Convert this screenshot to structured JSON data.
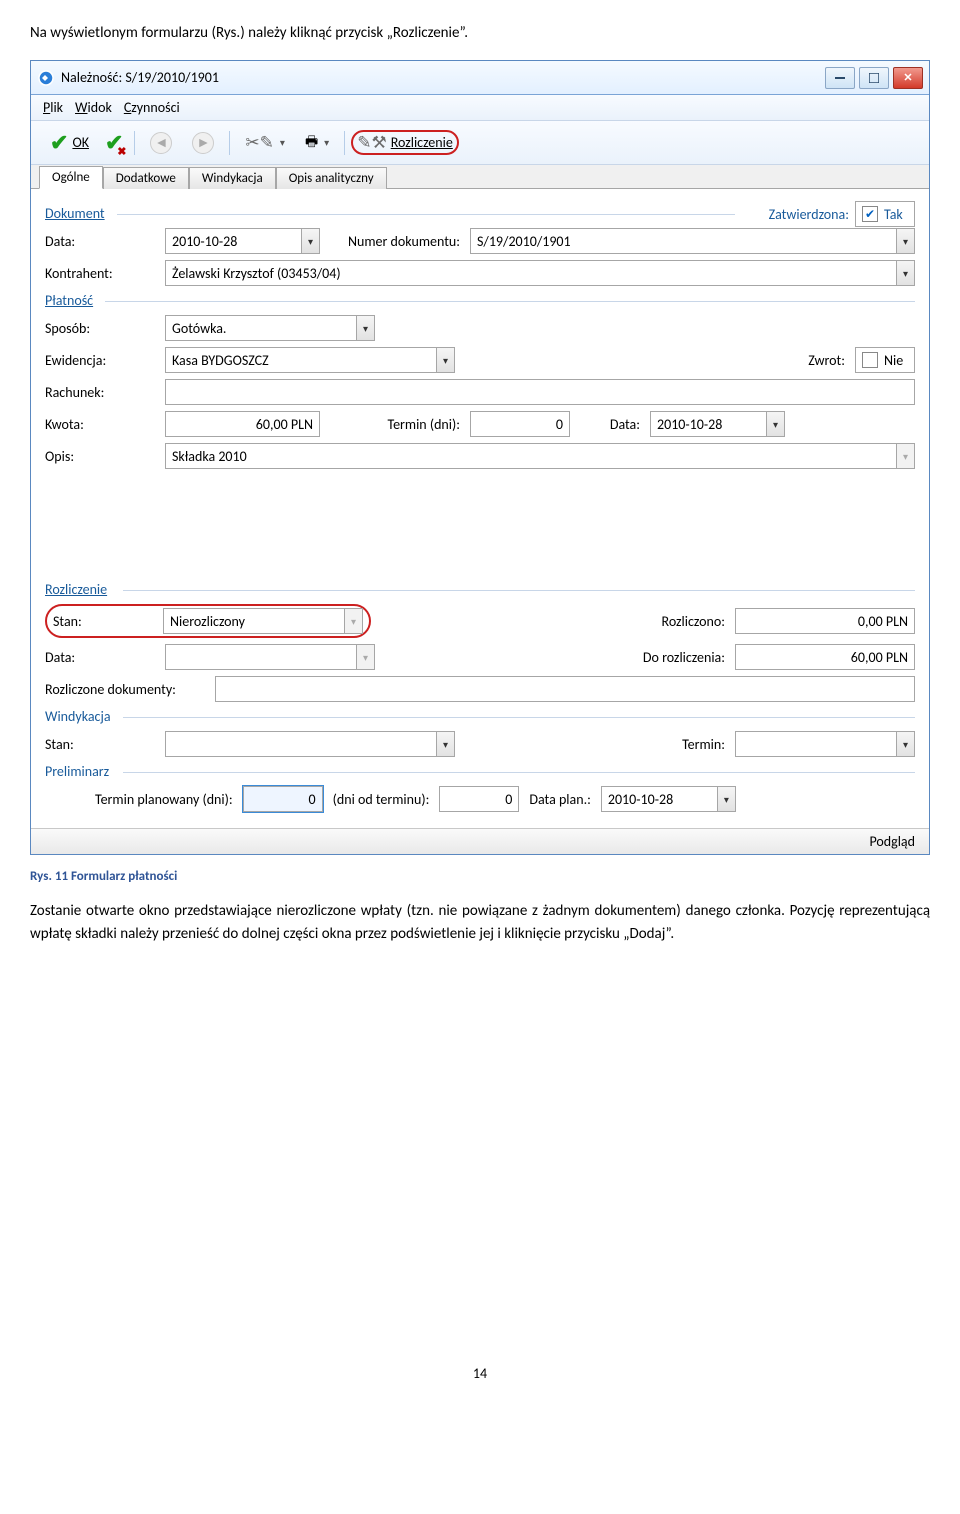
{
  "doc": {
    "intro": "Na wyświetlonym formularzu (Rys.) należy kliknąć przycisk „Rozliczenie”.",
    "caption": "Rys. 11 Formularz płatności",
    "body": "Zostanie otwarte okno przedstawiające nierozliczone wpłaty (tzn. nie powiązane z żadnym dokumentem) danego członka. Pozycję reprezentującą wpłatę składki należy przenieść do dolnej części okna przez podświetlenie jej i kliknięcie przycisku „Dodaj”.",
    "page_number": "14"
  },
  "win": {
    "title": "Należność: S/19/2010/1901",
    "menu": {
      "plik": "Plik",
      "widok": "Widok",
      "czynnosci": "Czynności"
    },
    "toolbar": {
      "ok": "OK",
      "rozliczenie": "Rozliczenie"
    },
    "tabs": {
      "ogolne": "Ogólne",
      "dodatkowe": "Dodatkowe",
      "windykacja": "Windykacja",
      "opis": "Opis analityczny"
    },
    "dokument": {
      "title": "Dokument",
      "zatw_label": "Zatwierdzona:",
      "zatw_value": "Tak",
      "data_label": "Data:",
      "data_value": "2010-10-28",
      "numer_label": "Numer dokumentu:",
      "numer_value": "S/19/2010/1901",
      "kontr_label": "Kontrahent:",
      "kontr_value": "Żelawski Krzysztof (03453/04)"
    },
    "platnosc": {
      "title": "Płatność",
      "sposob_label": "Sposób:",
      "sposob_value": "Gotówka.",
      "ewidencja_label": "Ewidencja:",
      "ewidencja_value": "Kasa BYDGOSZCZ",
      "zwrot_label": "Zwrot:",
      "zwrot_value": "Nie",
      "rachunek_label": "Rachunek:",
      "kwota_label": "Kwota:",
      "kwota_value": "60,00 PLN",
      "termin_label": "Termin (dni):",
      "termin_value": "0",
      "data2_label": "Data:",
      "data2_value": "2010-10-28",
      "opis_label": "Opis:",
      "opis_value": "Składka 2010"
    },
    "rozliczenie": {
      "title": "Rozliczenie",
      "stan_label": "Stan:",
      "stan_value": "Nierozliczony",
      "rozliczono_label": "Rozliczono:",
      "rozliczono_value": "0,00 PLN",
      "data_label": "Data:",
      "dorozl_label": "Do rozliczenia:",
      "dorozl_value": "60,00 PLN",
      "rozldok_label": "Rozliczone dokumenty:"
    },
    "windykacja": {
      "title": "Windykacja",
      "stan_label": "Stan:",
      "termin_label": "Termin:"
    },
    "preliminarz": {
      "title": "Preliminarz",
      "termin_plan_label": "Termin planowany (dni):",
      "termin_plan_value": "0",
      "dni_od_label": "(dni od terminu):",
      "dni_od_value": "0",
      "data_plan_label": "Data plan.:",
      "data_plan_value": "2010-10-28"
    },
    "footer": {
      "podglad": "Podgląd"
    }
  }
}
